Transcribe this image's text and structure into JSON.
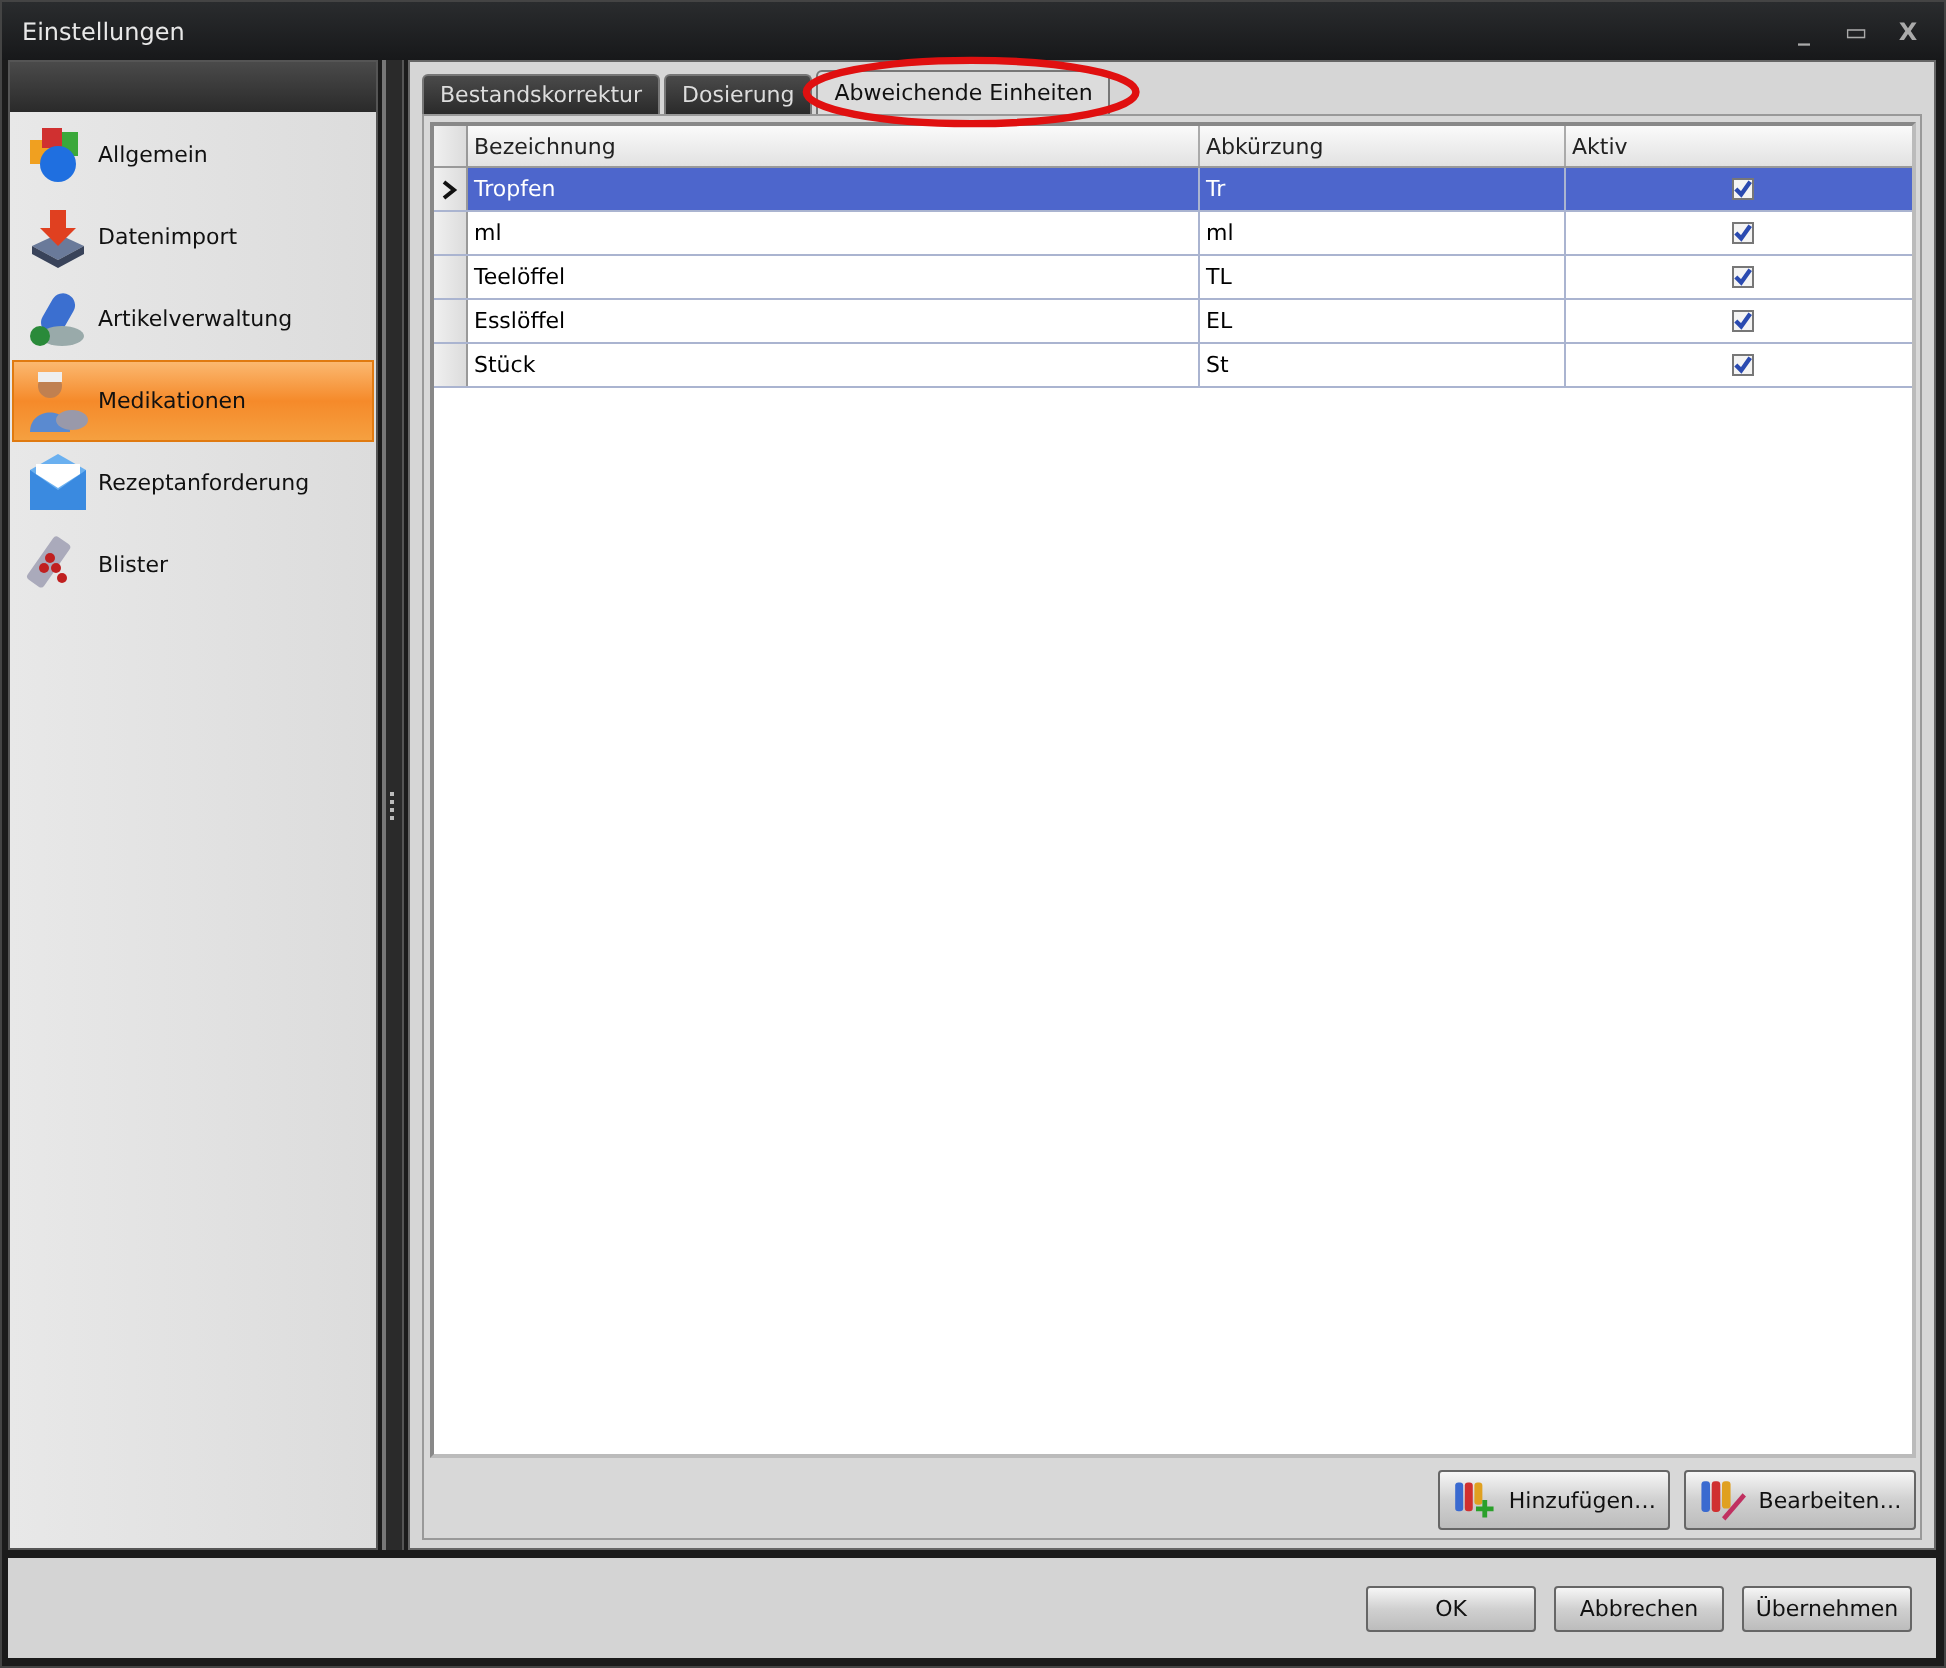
{
  "window": {
    "title": "Einstellungen",
    "controls": [
      "_",
      "▭",
      "X"
    ]
  },
  "sidebar": {
    "items": [
      {
        "label": "Allgemein",
        "selected": false
      },
      {
        "label": "Datenimport",
        "selected": false
      },
      {
        "label": "Artikelverwaltung",
        "selected": false
      },
      {
        "label": "Medikationen",
        "selected": true
      },
      {
        "label": "Rezeptanforderung",
        "selected": false
      },
      {
        "label": "Blister",
        "selected": false
      }
    ]
  },
  "tabs": [
    {
      "label": "Bestandskorrektur",
      "selected": false
    },
    {
      "label": "Dosierung",
      "selected": false
    },
    {
      "label": "Abweichende Einheiten",
      "selected": true,
      "highlighted": true
    }
  ],
  "table": {
    "columns": [
      "Bezeichnung",
      "Abkürzung",
      "Aktiv"
    ],
    "rows": [
      {
        "name": "Tropfen",
        "abbr": "Tr",
        "active": true,
        "selected": true
      },
      {
        "name": "ml",
        "abbr": "ml",
        "active": true,
        "selected": false
      },
      {
        "name": "Teelöffel",
        "abbr": "TL",
        "active": true,
        "selected": false
      },
      {
        "name": "Esslöffel",
        "abbr": "EL",
        "active": true,
        "selected": false
      },
      {
        "name": "Stück",
        "abbr": "St",
        "active": true,
        "selected": false
      }
    ]
  },
  "actions": [
    {
      "label": "Hinzufügen…"
    },
    {
      "label": "Bearbeiten…"
    }
  ],
  "buttons": [
    "OK",
    "Abbrechen",
    "Übernehmen"
  ]
}
